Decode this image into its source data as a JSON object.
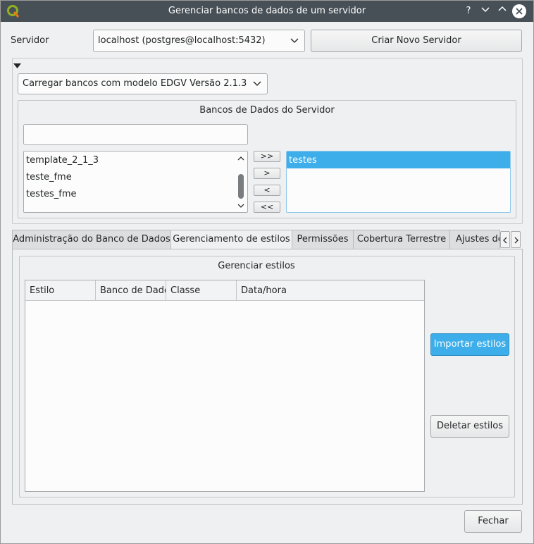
{
  "window": {
    "title": "Gerenciar bancos de dados de um servidor",
    "help": "?",
    "minimize": "⌄",
    "maximize": "⌃"
  },
  "server": {
    "label": "Servidor",
    "selected": "localhost (postgres@localhost:5432)",
    "create_button": "Criar Novo Servidor"
  },
  "template_combo": {
    "selected": "Carregar bancos com modelo EDGV Versão 2.1.3"
  },
  "databases": {
    "title": "Bancos de Dados do Servidor",
    "filter_value": "",
    "available": [
      "template_2_1_3",
      "teste_fme",
      "testes_fme"
    ],
    "selected": [
      "testes"
    ],
    "move_buttons": {
      "all_right": ">>",
      "right": ">",
      "left": "<",
      "all_left": "<<"
    }
  },
  "tabs": [
    {
      "label": "Administração do Banco de Dados",
      "active": false
    },
    {
      "label": "Gerenciamento de estilos",
      "active": true
    },
    {
      "label": "Permissões",
      "active": false
    },
    {
      "label": "Cobertura Terrestre",
      "active": false
    },
    {
      "label": "Ajustes de",
      "active": false
    }
  ],
  "styles": {
    "title": "Gerenciar estilos",
    "columns": [
      "Estilo",
      "Banco de Dados",
      "Classe",
      "Data/hora"
    ],
    "rows": [],
    "import_button": "Importar estilos",
    "delete_button": "Deletar estilos"
  },
  "close_button": "Fechar",
  "colors": {
    "titlebar": "#475057",
    "accent": "#3daee9",
    "window_bg": "#eff0f1"
  }
}
